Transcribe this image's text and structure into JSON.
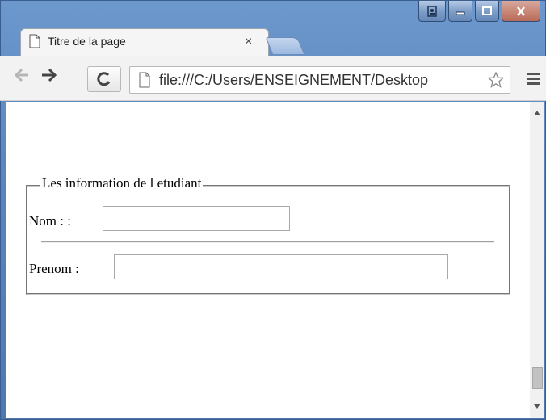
{
  "browser": {
    "tab_title": "Titre de la page",
    "tab_close": "×",
    "url": "file:///C:/Users/ENSEIGNEMENT/Desktop"
  },
  "page": {
    "legend": "Les information de l etudiant",
    "nom_label": "Nom : :",
    "nom_value": "",
    "prenom_label": "Prenom :",
    "prenom_value": ""
  },
  "colors": {
    "frame": "#5b86bd",
    "toolbar": "#f2f2f2"
  }
}
